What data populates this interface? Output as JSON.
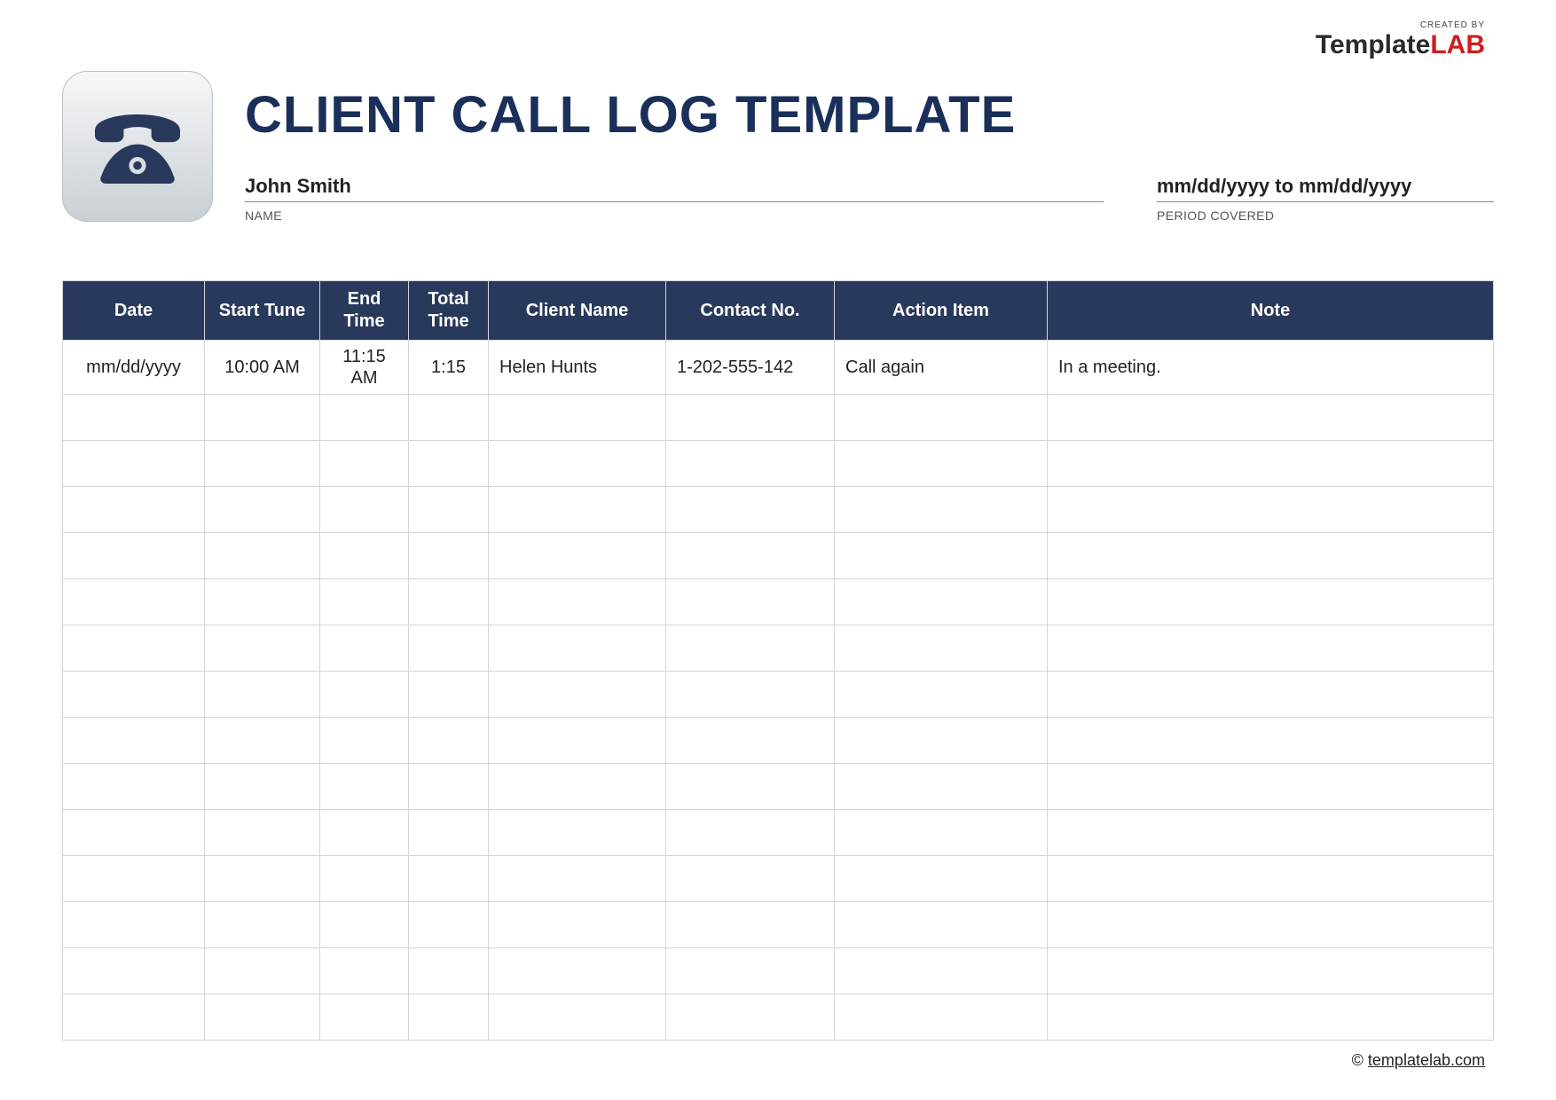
{
  "brand": {
    "created_by": "CREATED BY",
    "name_part1": "Template",
    "name_part2": "LAB"
  },
  "title": "CLIENT CALL LOG TEMPLATE",
  "meta": {
    "name_value": "John Smith",
    "name_label": "NAME",
    "period_value": "mm/dd/yyyy to mm/dd/yyyy",
    "period_label": "PERIOD COVERED"
  },
  "columns": [
    "Date",
    "Start Tune",
    "End Time",
    "Total Time",
    "Client Name",
    "Contact No.",
    "Action Item",
    "Note"
  ],
  "rows": [
    {
      "date": "mm/dd/yyyy",
      "start": "10:00 AM",
      "end": "11:15 AM",
      "total": "1:15",
      "client": "Helen Hunts",
      "contact": "1-202-555-142",
      "action": "Call again",
      "note": "In a meeting."
    },
    {
      "date": "",
      "start": "",
      "end": "",
      "total": "",
      "client": "",
      "contact": "",
      "action": "",
      "note": ""
    },
    {
      "date": "",
      "start": "",
      "end": "",
      "total": "",
      "client": "",
      "contact": "",
      "action": "",
      "note": ""
    },
    {
      "date": "",
      "start": "",
      "end": "",
      "total": "",
      "client": "",
      "contact": "",
      "action": "",
      "note": ""
    },
    {
      "date": "",
      "start": "",
      "end": "",
      "total": "",
      "client": "",
      "contact": "",
      "action": "",
      "note": ""
    },
    {
      "date": "",
      "start": "",
      "end": "",
      "total": "",
      "client": "",
      "contact": "",
      "action": "",
      "note": ""
    },
    {
      "date": "",
      "start": "",
      "end": "",
      "total": "",
      "client": "",
      "contact": "",
      "action": "",
      "note": ""
    },
    {
      "date": "",
      "start": "",
      "end": "",
      "total": "",
      "client": "",
      "contact": "",
      "action": "",
      "note": ""
    },
    {
      "date": "",
      "start": "",
      "end": "",
      "total": "",
      "client": "",
      "contact": "",
      "action": "",
      "note": ""
    },
    {
      "date": "",
      "start": "",
      "end": "",
      "total": "",
      "client": "",
      "contact": "",
      "action": "",
      "note": ""
    },
    {
      "date": "",
      "start": "",
      "end": "",
      "total": "",
      "client": "",
      "contact": "",
      "action": "",
      "note": ""
    },
    {
      "date": "",
      "start": "",
      "end": "",
      "total": "",
      "client": "",
      "contact": "",
      "action": "",
      "note": ""
    },
    {
      "date": "",
      "start": "",
      "end": "",
      "total": "",
      "client": "",
      "contact": "",
      "action": "",
      "note": ""
    },
    {
      "date": "",
      "start": "",
      "end": "",
      "total": "",
      "client": "",
      "contact": "",
      "action": "",
      "note": ""
    },
    {
      "date": "",
      "start": "",
      "end": "",
      "total": "",
      "client": "",
      "contact": "",
      "action": "",
      "note": ""
    }
  ],
  "footer": {
    "copyright": "©",
    "link_text": "templatelab.com"
  }
}
